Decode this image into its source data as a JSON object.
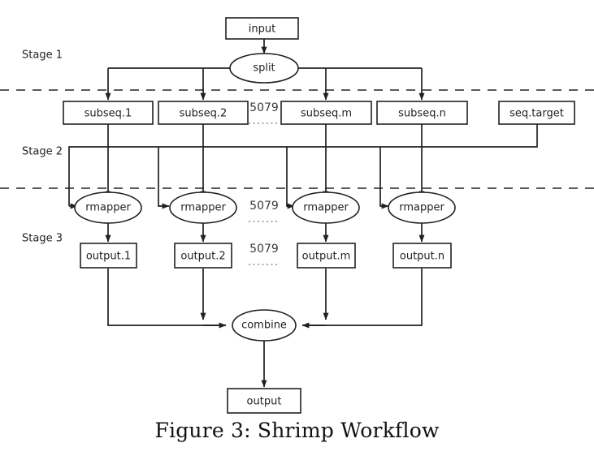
{
  "figure": {
    "caption": "Figure 3: Shrimp Workflow",
    "background_color": "#ffffff",
    "line_color": "#231f20",
    "divider_color": "#5a5a5a"
  },
  "stages": [
    {
      "id": "stage-1",
      "label": "Stage 1"
    },
    {
      "id": "stage-2",
      "label": "Stage 2"
    },
    {
      "id": "stage-3",
      "label": "Stage 3"
    }
  ],
  "nodes": {
    "input": {
      "label": "input",
      "shape": "box"
    },
    "split": {
      "label": "split",
      "shape": "ellipse"
    },
    "subseq_1": {
      "label": "subseq.1",
      "shape": "box"
    },
    "subseq_2": {
      "label": "subseq.2",
      "shape": "box"
    },
    "subseq_m": {
      "label": "subseq.m",
      "shape": "box"
    },
    "subseq_n": {
      "label": "subseq.n",
      "shape": "box"
    },
    "seq_target": {
      "label": "seq.target",
      "shape": "box"
    },
    "rmapper_1": {
      "label": "rmapper",
      "shape": "ellipse"
    },
    "rmapper_2": {
      "label": "rmapper",
      "shape": "ellipse"
    },
    "rmapper_m": {
      "label": "rmapper",
      "shape": "ellipse"
    },
    "rmapper_n": {
      "label": "rmapper",
      "shape": "ellipse"
    },
    "output_1": {
      "label": "output.1",
      "shape": "box"
    },
    "output_2": {
      "label": "output.2",
      "shape": "box"
    },
    "output_m": {
      "label": "output.m",
      "shape": "box"
    },
    "output_n": {
      "label": "output.n",
      "shape": "box"
    },
    "combine": {
      "label": "combine",
      "shape": "ellipse"
    },
    "output": {
      "label": "output",
      "shape": "box"
    }
  },
  "counts": {
    "subseq_count": "5079",
    "rmapper_count": "5079",
    "output_count": "5079"
  }
}
